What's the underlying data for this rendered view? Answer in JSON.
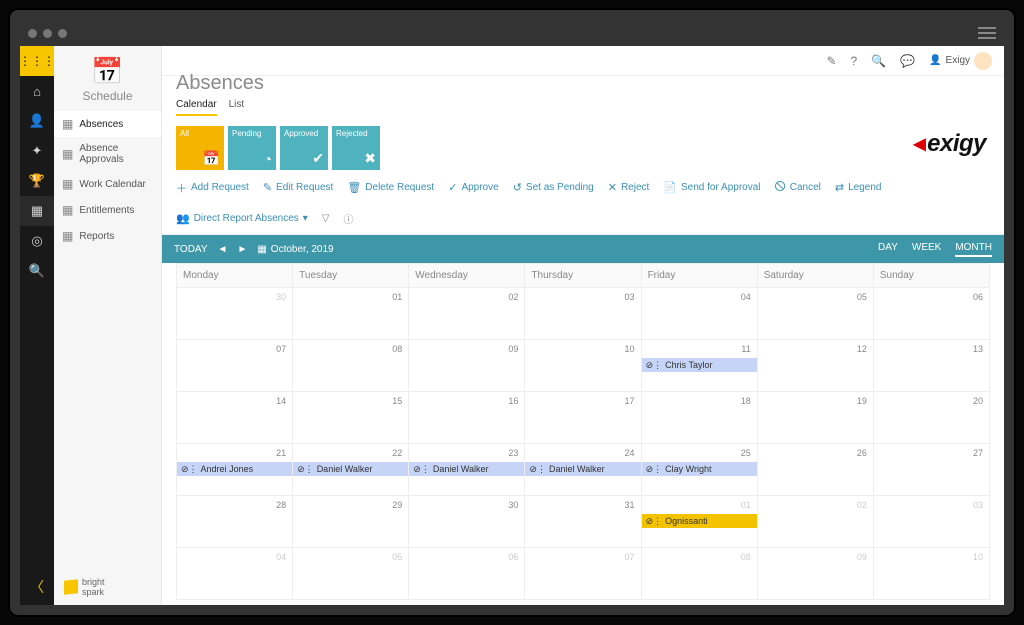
{
  "header": {
    "user_label": "Exigy"
  },
  "page": {
    "title": "Absences",
    "tabs": [
      {
        "label": "Calendar",
        "selected": true
      },
      {
        "label": "List",
        "selected": false
      }
    ]
  },
  "side_panel": {
    "title": "Schedule",
    "items": [
      {
        "label": "Absences",
        "selected": true
      },
      {
        "label": "Absence Approvals"
      },
      {
        "label": "Work Calendar"
      },
      {
        "label": "Entitlements"
      },
      {
        "label": "Reports"
      }
    ],
    "brand_line1": "bright",
    "brand_line2": "spark"
  },
  "filter_cards": [
    {
      "label": "All",
      "class": "fc-all",
      "icon": "📅"
    },
    {
      "label": "Pending",
      "class": "fc-teal",
      "icon": "◔"
    },
    {
      "label": "Approved",
      "class": "fc-teal",
      "icon": "✔"
    },
    {
      "label": "Rejected",
      "class": "fc-teal",
      "icon": "✖"
    }
  ],
  "toolbar": [
    {
      "label": "Add Request",
      "icon": "＋"
    },
    {
      "label": "Edit Request",
      "icon": "✎"
    },
    {
      "label": "Delete Request",
      "icon": "🗑"
    },
    {
      "label": "Approve",
      "icon": "✓"
    },
    {
      "label": "Set as Pending",
      "icon": "↺"
    },
    {
      "label": "Reject",
      "icon": "✕"
    },
    {
      "label": "Send for Approval",
      "icon": "📄"
    },
    {
      "label": "Cancel",
      "icon": "🛇"
    },
    {
      "label": "Legend",
      "icon": "⇄"
    },
    {
      "label": "Direct Report Absences",
      "icon": "👥",
      "dropdown": true
    }
  ],
  "cal_header": {
    "today": "TODAY",
    "month_label": "October, 2019",
    "views": [
      {
        "label": "DAY"
      },
      {
        "label": "WEEK"
      },
      {
        "label": "MONTH",
        "selected": true
      }
    ],
    "days": [
      "Monday",
      "Tuesday",
      "Wednesday",
      "Thursday",
      "Friday",
      "Saturday",
      "Sunday"
    ]
  },
  "weeks": [
    {
      "cells": [
        {
          "n": "30",
          "dim": true
        },
        {
          "n": "01"
        },
        {
          "n": "02"
        },
        {
          "n": "03"
        },
        {
          "n": "04"
        },
        {
          "n": "05"
        },
        {
          "n": "06"
        }
      ]
    },
    {
      "cells": [
        {
          "n": "07"
        },
        {
          "n": "08"
        },
        {
          "n": "09"
        },
        {
          "n": "10"
        },
        {
          "n": "11",
          "event": {
            "text": "Chris Taylor",
            "class": "ev-blue"
          }
        },
        {
          "n": "12"
        },
        {
          "n": "13"
        }
      ]
    },
    {
      "cells": [
        {
          "n": "14"
        },
        {
          "n": "15"
        },
        {
          "n": "16"
        },
        {
          "n": "17"
        },
        {
          "n": "18"
        },
        {
          "n": "19"
        },
        {
          "n": "20"
        }
      ]
    },
    {
      "cells": [
        {
          "n": "21",
          "event": {
            "text": "Andrei Jones",
            "class": "ev-blue"
          }
        },
        {
          "n": "22",
          "event": {
            "text": "Daniel Walker",
            "class": "ev-blue"
          }
        },
        {
          "n": "23",
          "event": {
            "text": "Daniel Walker",
            "class": "ev-blue"
          }
        },
        {
          "n": "24",
          "event": {
            "text": "Daniel Walker",
            "class": "ev-blue"
          }
        },
        {
          "n": "25",
          "event": {
            "text": "Clay Wright",
            "class": "ev-blue"
          }
        },
        {
          "n": "26"
        },
        {
          "n": "27"
        }
      ]
    },
    {
      "cells": [
        {
          "n": "28"
        },
        {
          "n": "29"
        },
        {
          "n": "30"
        },
        {
          "n": "31"
        },
        {
          "n": "01",
          "dim": true,
          "event": {
            "text": "Ognissanti",
            "class": "ev-yellow"
          }
        },
        {
          "n": "02",
          "dim": true
        },
        {
          "n": "03",
          "dim": true
        }
      ]
    },
    {
      "cells": [
        {
          "n": "04",
          "dim": true
        },
        {
          "n": "05",
          "dim": true
        },
        {
          "n": "06",
          "dim": true
        },
        {
          "n": "07",
          "dim": true
        },
        {
          "n": "08",
          "dim": true
        },
        {
          "n": "09",
          "dim": true
        },
        {
          "n": "10",
          "dim": true
        }
      ]
    }
  ],
  "rail_icons": [
    "⌂",
    "👤",
    "✦",
    "🏆",
    "▦",
    "◎",
    "🔍"
  ]
}
